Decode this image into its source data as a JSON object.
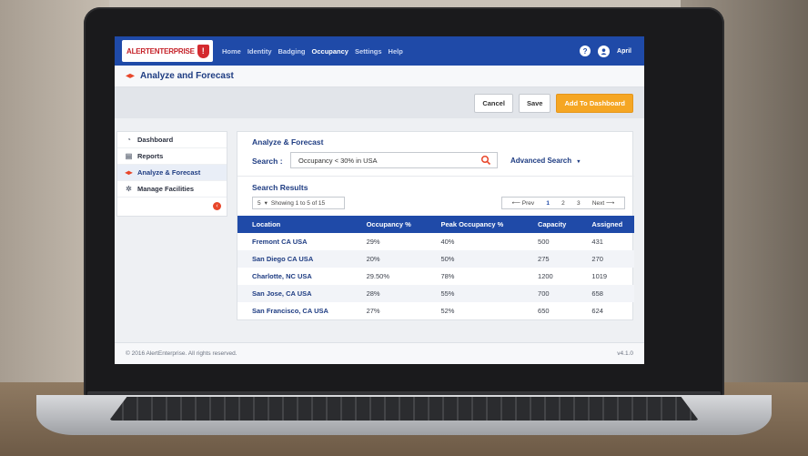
{
  "navbar": {
    "logo_text": "ALERTENTERPRISE",
    "items": [
      "Home",
      "Identity",
      "Badging",
      "Occupancy",
      "Settings",
      "Help"
    ],
    "active": "Occupancy",
    "user": "April"
  },
  "page": {
    "title": "Analyze and Forecast"
  },
  "actions": {
    "cancel": "Cancel",
    "save": "Save",
    "add_dashboard": "Add To Dashboard"
  },
  "sidebar": {
    "items": [
      {
        "label": "Dashboard"
      },
      {
        "label": "Reports"
      },
      {
        "label": "Analyze & Forecast"
      },
      {
        "label": "Manage Facilities"
      }
    ]
  },
  "panel": {
    "title": "Analyze & Forecast",
    "search_label": "Search :",
    "search_value": "Occupancy < 30% in USA",
    "advanced_search": "Advanced Search",
    "results_title": "Search Results",
    "page_size": "5",
    "showing": "Showing 1 to 5 of 15",
    "pager": {
      "prev": "Prev",
      "pages": [
        "1",
        "2",
        "3"
      ],
      "next": "Next"
    }
  },
  "table": {
    "headers": [
      "Location",
      "Occupancy %",
      "Peak Occupancy %",
      "Capacity",
      "Assigned"
    ],
    "rows": [
      [
        "Fremont CA USA",
        "29%",
        "40%",
        "500",
        "431"
      ],
      [
        "San Diego CA USA",
        "20%",
        "50%",
        "275",
        "270"
      ],
      [
        "Charlotte, NC USA",
        "29.50%",
        "78%",
        "1200",
        "1019"
      ],
      [
        "San Jose, CA USA",
        "28%",
        "55%",
        "700",
        "658"
      ],
      [
        "San Francisco, CA USA",
        "27%",
        "52%",
        "650",
        "624"
      ]
    ]
  },
  "footer": {
    "copyright": "© 2016 AlertEnterprise. All rights reserved.",
    "version": "v4.1.0"
  }
}
